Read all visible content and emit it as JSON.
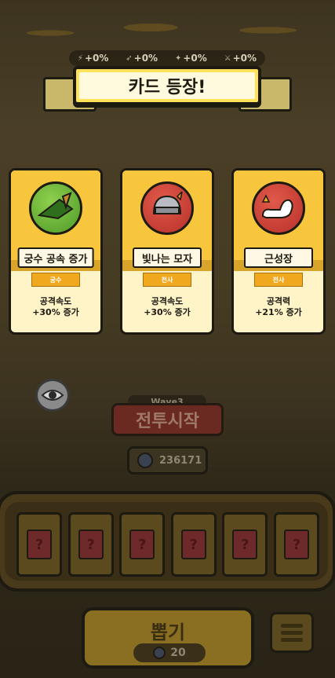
{
  "stats": [
    "+0%",
    "+0%",
    "+0%",
    "+0%"
  ],
  "banner_title": "카드 등장!",
  "cards": [
    {
      "name": "궁수 공속 증가",
      "class": "궁수",
      "desc1": "공격속도",
      "desc2": "+30% 증가",
      "icon": "archer-hat-icon"
    },
    {
      "name": "빛나는 모자",
      "class": "전사",
      "desc1": "공격속도",
      "desc2": "+30% 증가",
      "icon": "helmet-icon"
    },
    {
      "name": "근성장",
      "class": "전사",
      "desc1": "공격력",
      "desc2": "+21% 증가",
      "icon": "muscle-arm-icon"
    }
  ],
  "wave": "Wave3",
  "start_button": "전투시작",
  "coins": "236171",
  "slots": [
    "?",
    "?",
    "?",
    "?",
    "?",
    "?"
  ],
  "draw_button": "뽑기",
  "draw_cost": "20",
  "colors": {
    "card_top": "#f7c63c",
    "card_body": "#fff3c8",
    "banner": "#ffe25a"
  }
}
